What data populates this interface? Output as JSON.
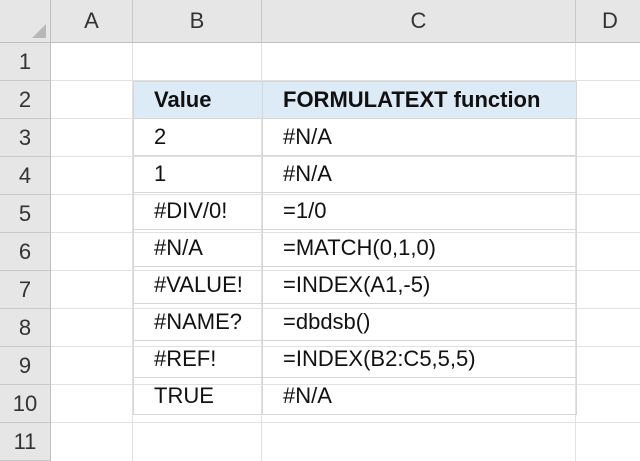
{
  "columns": [
    "A",
    "B",
    "C",
    "D"
  ],
  "rows": [
    "1",
    "2",
    "3",
    "4",
    "5",
    "6",
    "7",
    "8",
    "9",
    "10",
    "11"
  ],
  "table": {
    "headers": [
      "Value",
      "FORMULATEXT function"
    ],
    "rows": [
      [
        "2",
        "#N/A"
      ],
      [
        "1",
        "#N/A"
      ],
      [
        "#DIV/0!",
        "=1/0"
      ],
      [
        "#N/A",
        "=MATCH(0,1,0)"
      ],
      [
        "#VALUE!",
        "=INDEX(A1,-5)"
      ],
      [
        "#NAME?",
        "=dbdsb()"
      ],
      [
        "#REF!",
        "=INDEX(B2:C5,5,5)"
      ],
      [
        "TRUE",
        "#N/A"
      ]
    ]
  },
  "colors": {
    "header_fill": "#ddebf7",
    "grid_header_bg": "#e6e6e6"
  }
}
